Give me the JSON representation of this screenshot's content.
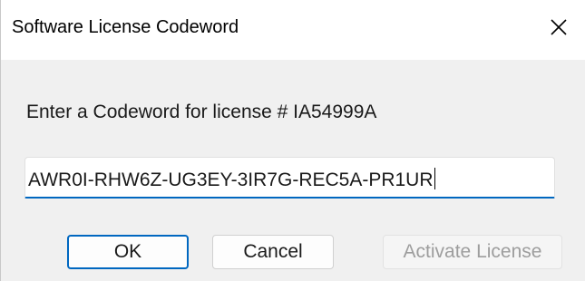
{
  "window": {
    "title": "Software License Codeword",
    "close_icon": "close-icon"
  },
  "form": {
    "prompt": "Enter a Codeword for license # IA54999A",
    "codeword_value": "AWR0I-RHW6Z-UG3EY-3IR7G-REC5A-PR1UR"
  },
  "buttons": {
    "ok_label": "OK",
    "cancel_label": "Cancel",
    "activate_label": "Activate License",
    "activate_enabled": false
  },
  "colors": {
    "accent": "#0067c0",
    "disabled_text": "#9d9d9d"
  }
}
